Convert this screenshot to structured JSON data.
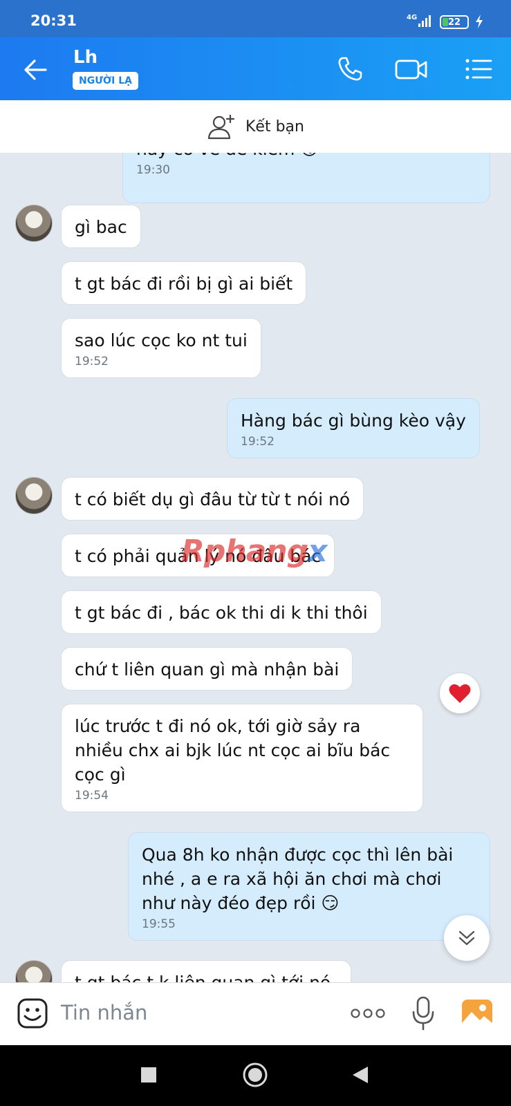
{
  "status_bar": {
    "time": "20:31",
    "network": "4G",
    "battery": "22",
    "battery_level": 0.22
  },
  "header": {
    "contact_name": "Lh",
    "tag": "NGƯỜI LẠ",
    "icons": [
      "back-arrow-icon",
      "phone-icon",
      "video-camera-icon",
      "menu-list-icon"
    ]
  },
  "add_friend": {
    "label": "Kết bạn",
    "icon": "add-person-icon"
  },
  "messages": [
    {
      "dir": "out",
      "text": "hay có về để kiếm 😏",
      "time": "19:30"
    },
    {
      "dir": "in",
      "text": "gì bac"
    },
    {
      "dir": "in",
      "text": "t gt bác đi rồi bị gì ai biết"
    },
    {
      "dir": "in",
      "text": "sao lúc cọc ko nt tui",
      "time": "19:52"
    },
    {
      "dir": "out",
      "text": "Hàng bác gì bùng kèo vậy",
      "time": "19:52"
    },
    {
      "dir": "in",
      "text": "t có biết dụ gì đâu từ từ t nói nó"
    },
    {
      "dir": "in",
      "text": "t có phải quản lý nó đâu bác"
    },
    {
      "dir": "in",
      "text": "t gt bác đi , bác ok thi di k thi thôi"
    },
    {
      "dir": "in",
      "text": "chứ t liên quan gì mà nhận bài"
    },
    {
      "dir": "in",
      "text": "lúc trước t đi nó ok, tới giờ sảy ra nhiều chx ai bjk lúc nt cọc ai bĩu bác cọc gì",
      "time": "19:54"
    },
    {
      "dir": "out",
      "text": "Qua 8h ko nhận được cọc thì lên bài nhé , a e ra xã hội ăn chơi mà chơi như này đéo đẹp rồi 😏",
      "time": "19:55"
    },
    {
      "dir": "in",
      "text": "t gt bác t k liên quan gì tới nó"
    }
  ],
  "reaction": "❤️",
  "watermark": {
    "part1": "Rphang",
    "part2": "x"
  },
  "composer": {
    "placeholder": "Tin nhắn",
    "icons": [
      "sticker-icon",
      "more-dots-icon",
      "microphone-icon",
      "image-gallery-icon"
    ]
  },
  "nav_bar": {
    "icons": [
      "recents-square-icon",
      "home-circle-icon",
      "back-triangle-icon"
    ]
  }
}
